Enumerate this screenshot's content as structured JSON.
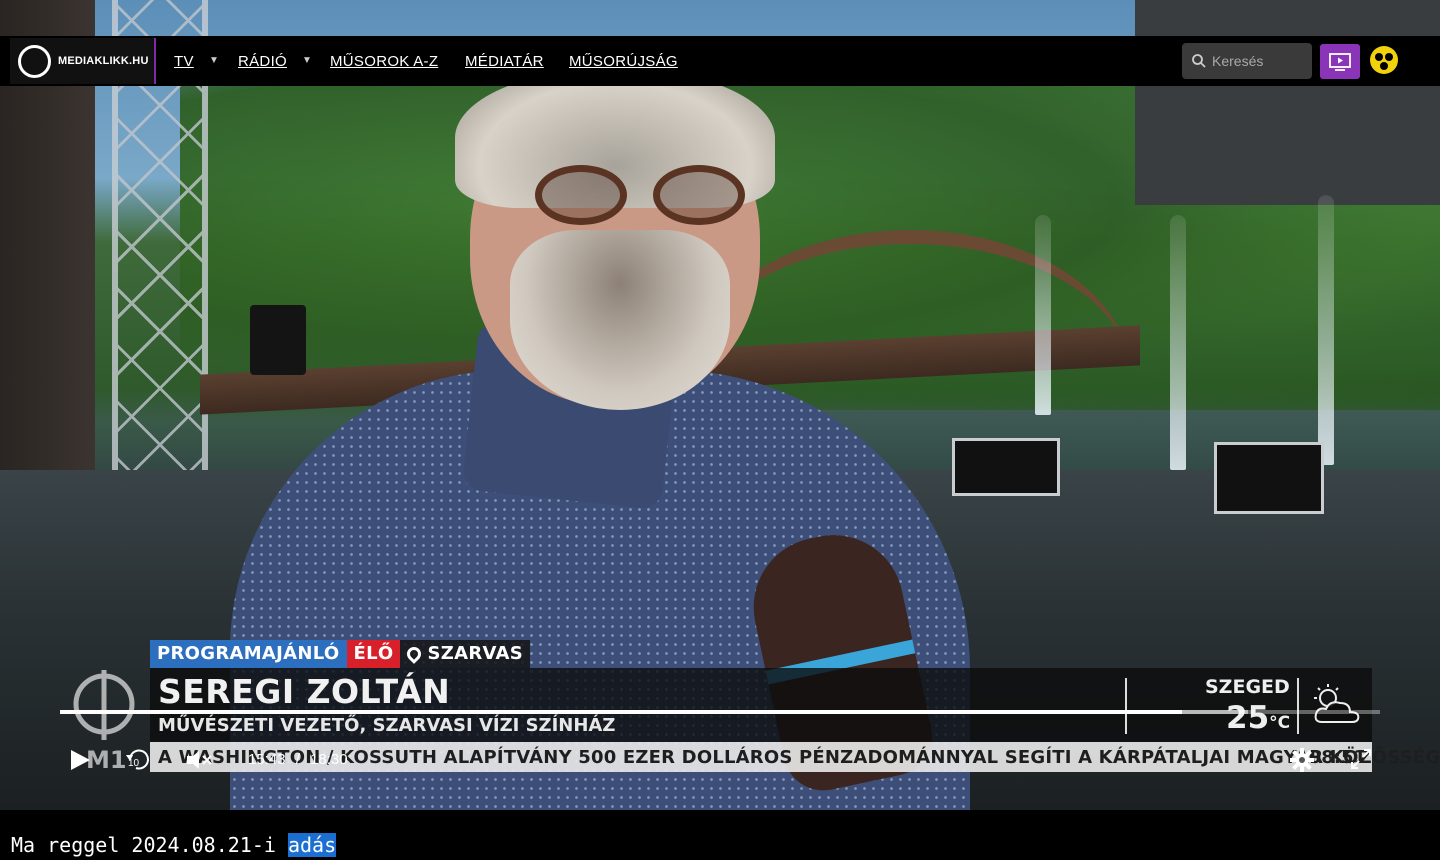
{
  "site": {
    "brand_text": "MEDIAKLIKK.HU"
  },
  "nav": {
    "items": [
      {
        "label": "TV",
        "has_dropdown": true
      },
      {
        "label": "RÁDIÓ",
        "has_dropdown": true
      },
      {
        "label": "MŰSOROK A-Z",
        "has_dropdown": false
      },
      {
        "label": "MÉDIATÁR",
        "has_dropdown": false
      },
      {
        "label": "MŰSORÚJSÁG",
        "has_dropdown": false
      }
    ],
    "search_placeholder": "Keresés",
    "tv_icon": "tv-play-icon",
    "accessibility_icon": "accessibility-icon"
  },
  "broadcast": {
    "tag_program": "PROGRAMAJÁNLÓ",
    "tag_live": "ÉLŐ",
    "location": "SZARVAS",
    "name": "SEREGI ZOLTÁN",
    "role": "MŰVÉSZETI VEZETŐ, SZARVASI VÍZI SZÍNHÁZ",
    "weather_city": "SZEGED",
    "weather_temp": "25",
    "weather_unit": "°C",
    "ticker_text": "A WASHINGTON / KOSSUTH ALAPÍTVÁNY 500 EZER DOLLÁROS PÉNZADOMÁNNYAL SEGÍTI A KÁRPÁTALJAI MAGYAR KÖZÖSSÉGET",
    "ticker_time": "08:51",
    "channel_logo": "M1"
  },
  "player": {
    "current_time": "15:43",
    "separator": "/",
    "duration": "18:30",
    "progress_fraction": 0.85,
    "buffer_fraction": 0.9,
    "rewind_seconds": "10"
  },
  "caption": {
    "prefix": "Ma reggel 2024.08.21-i ",
    "highlight": "adás"
  },
  "colors": {
    "accent": "#8a35b8",
    "tag_blue": "#2d6fbf",
    "tag_red": "#d8202a",
    "highlight": "#1a6fd1"
  }
}
